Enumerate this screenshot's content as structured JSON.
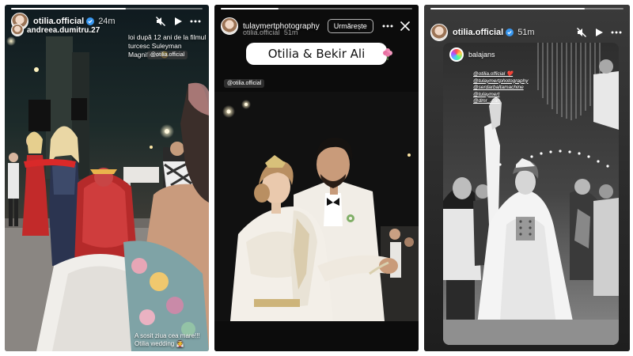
{
  "story1": {
    "progress": 0.6,
    "username": "otilia.official",
    "time": "24m",
    "sub_username": "andreea.dumitru.27",
    "caption": "loi după 12 ani de la filmul turcesc Suleyman Magnificul 😄",
    "mention": "@otilia.official",
    "bottom_caption": [
      "A sosit ziua cea mare!!!",
      "Otilia wedding 👰"
    ],
    "icons": [
      "verified-icon",
      "mute-icon",
      "play-icon",
      "more-icon"
    ]
  },
  "story2": {
    "progress": 0.3,
    "username": "tulaymertphotography",
    "overlay_username": "otilia.official",
    "time": "51m",
    "follow_label": "Urmărește",
    "title": "Otilia & Bekir Ali",
    "mention": "@otilia.official",
    "icons": [
      "more-icon",
      "close-icon",
      "flower-icon"
    ]
  },
  "story3": {
    "progress": 0.8,
    "username": "otilia.official",
    "time": "51m",
    "repost_username": "balajans",
    "mentions": [
      "@otilia.official ❤️",
      "@tulaymertphotography",
      "@serdarbaltamachine",
      "@tulaymert",
      "@dmr_.can"
    ],
    "icons": [
      "verified-icon",
      "mute-icon",
      "play-icon",
      "more-icon"
    ]
  },
  "colors": {
    "verified": "#3897f0",
    "heart": "#e0245e"
  }
}
